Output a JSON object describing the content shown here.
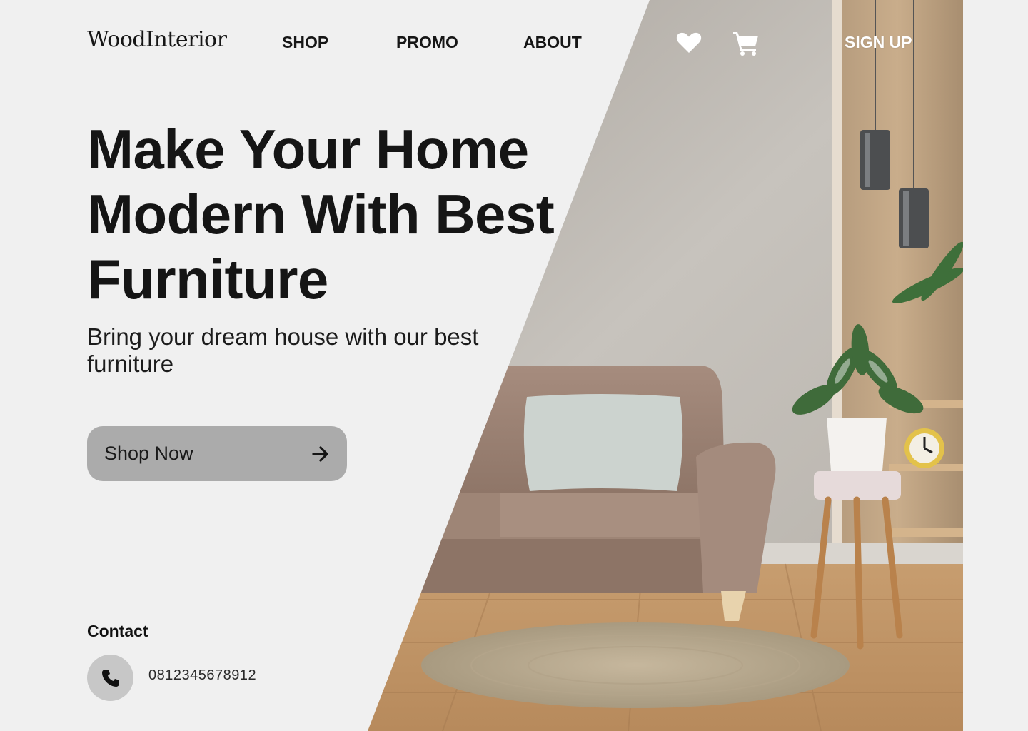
{
  "brand": {
    "name": "WoodInterior"
  },
  "nav": {
    "items": [
      {
        "label": "SHOP"
      },
      {
        "label": "PROMO"
      },
      {
        "label": "ABOUT"
      }
    ],
    "icons": [
      "heart-icon",
      "cart-icon"
    ],
    "signup_label": "SIGN UP"
  },
  "hero": {
    "headline": "Make Your Home Modern With Best Furniture",
    "subtext": "Bring your dream house with our best furniture",
    "cta_label": "Shop Now",
    "cta_icon": "arrow-right-icon",
    "image_icon": "living-room-photo"
  },
  "contact": {
    "heading": "Contact",
    "phone": "0812345678912",
    "phone_icon": "phone-icon"
  },
  "colors": {
    "background": "#f0f0f0",
    "text": "#151515",
    "button": "#ababab",
    "phone_circle": "#c7c7c7",
    "nav_on_image": "#ffffff"
  }
}
